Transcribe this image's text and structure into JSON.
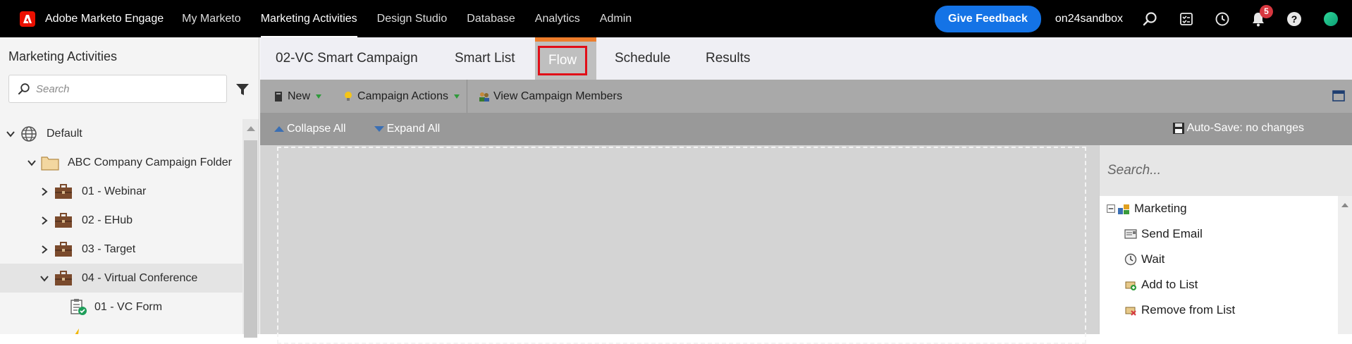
{
  "brand": {
    "name": "Adobe Marketo Engage",
    "logo_icon": "adobe-logo-icon"
  },
  "nav": {
    "items": [
      {
        "label": "My Marketo"
      },
      {
        "label": "Marketing Activities",
        "active": true
      },
      {
        "label": "Design Studio"
      },
      {
        "label": "Database"
      },
      {
        "label": "Analytics"
      },
      {
        "label": "Admin"
      }
    ],
    "feedback_label": "Give Feedback",
    "account": "on24sandbox",
    "notification_count": "5",
    "icons": [
      "search-icon",
      "tasks-icon",
      "history-icon",
      "bell-icon",
      "help-icon",
      "avatar"
    ]
  },
  "sidebar": {
    "title": "Marketing Activities",
    "search_placeholder": "Search",
    "tree": [
      {
        "label": "Default",
        "icon": "globe-icon",
        "expanded": true
      },
      {
        "label": "ABC Company Campaign Folder",
        "icon": "folder-icon",
        "expanded": true
      },
      {
        "label": "01 - Webinar",
        "icon": "briefcase-icon",
        "expanded": false
      },
      {
        "label": "02 - EHub",
        "icon": "briefcase-icon",
        "expanded": false
      },
      {
        "label": "03 - Target",
        "icon": "briefcase-icon",
        "expanded": false
      },
      {
        "label": "04 - Virtual Conference",
        "icon": "briefcase-icon",
        "expanded": true,
        "selected": true
      },
      {
        "label": "01 - VC Form",
        "icon": "form-icon"
      }
    ]
  },
  "tabs": [
    {
      "label": "02-VC Smart Campaign"
    },
    {
      "label": "Smart List"
    },
    {
      "label": "Flow",
      "active": true
    },
    {
      "label": "Schedule"
    },
    {
      "label": "Results"
    }
  ],
  "toolbar": {
    "new_label": "New",
    "campaign_actions_label": "Campaign Actions",
    "view_members_label": "View Campaign Members"
  },
  "subbar": {
    "collapse_label": "Collapse All",
    "expand_label": "Expand All",
    "autosave_label": "Auto-Save: no changes"
  },
  "palette": {
    "search_placeholder": "Search...",
    "group_label": "Marketing",
    "items": [
      {
        "label": "Send Email",
        "icon": "email-icon"
      },
      {
        "label": "Wait",
        "icon": "clock-icon"
      },
      {
        "label": "Add to List",
        "icon": "add-list-icon"
      },
      {
        "label": "Remove from List",
        "icon": "remove-list-icon"
      }
    ]
  },
  "colors": {
    "nav_bg": "#000000",
    "feedback_blue": "#1473e6",
    "active_tab_highlight": "#e10e18",
    "active_tab_top": "#ee7d2b",
    "notification_red": "#d7373f"
  }
}
